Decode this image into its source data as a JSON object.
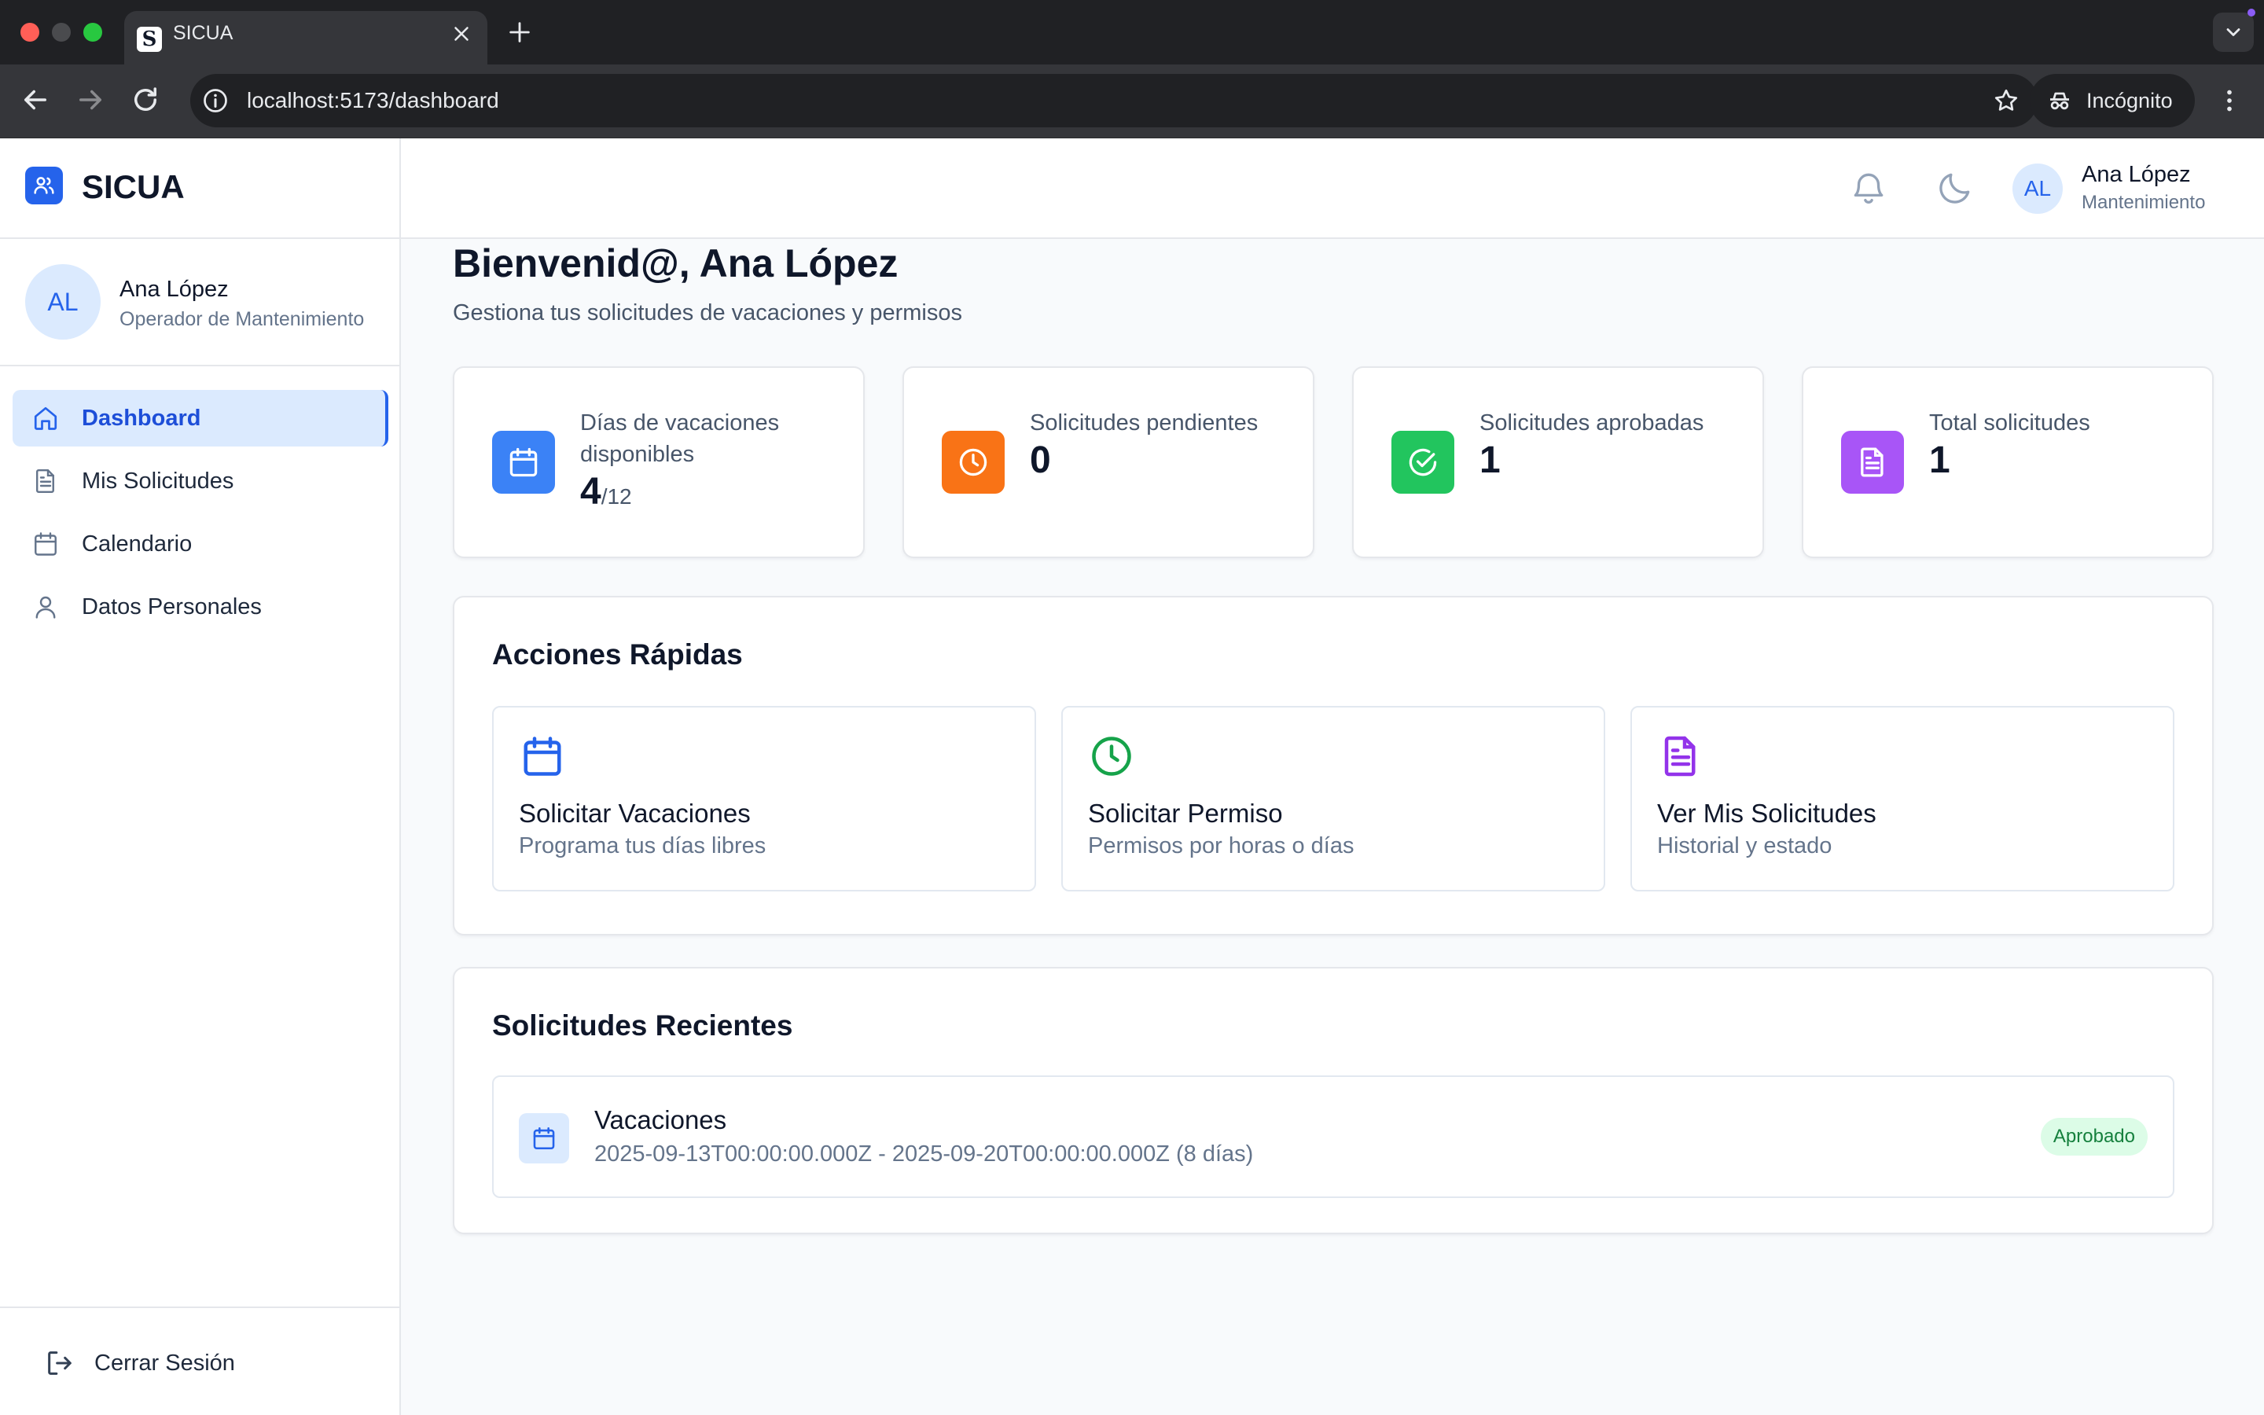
{
  "browser": {
    "tab_title": "SICUA",
    "favicon_letter": "S",
    "url": "localhost:5173/dashboard",
    "incognito_label": "Incógnito"
  },
  "app": {
    "name": "SICUA",
    "accent_color": "#2563eb"
  },
  "sidebar": {
    "user": {
      "initials": "AL",
      "name": "Ana López",
      "role": "Operador de Mantenimiento"
    },
    "items": [
      {
        "label": "Dashboard",
        "icon": "home-icon",
        "active": true
      },
      {
        "label": "Mis Solicitudes",
        "icon": "document-icon",
        "active": false
      },
      {
        "label": "Calendario",
        "icon": "calendar-icon",
        "active": false
      },
      {
        "label": "Datos Personales",
        "icon": "user-icon",
        "active": false
      }
    ],
    "logout_label": "Cerrar Sesión"
  },
  "header": {
    "user": {
      "initials": "AL",
      "name": "Ana López",
      "role": "Mantenimiento"
    }
  },
  "main": {
    "title": "Bienvenid@, Ana López",
    "subtitle": "Gestiona tus solicitudes de vacaciones y permisos",
    "stats": [
      {
        "label": "Días de vacaciones disponibles",
        "value": "4",
        "suffix": "/12",
        "icon": "calendar-icon",
        "color": "#3b82f6"
      },
      {
        "label": "Solicitudes pendientes",
        "value": "0",
        "icon": "clock-icon",
        "color": "#f97316"
      },
      {
        "label": "Solicitudes aprobadas",
        "value": "1",
        "icon": "check-circle-icon",
        "color": "#22c55e"
      },
      {
        "label": "Total solicitudes",
        "value": "1",
        "icon": "document-icon",
        "color": "#a855f7"
      }
    ],
    "quick_actions": {
      "title": "Acciones Rápidas",
      "items": [
        {
          "title": "Solicitar Vacaciones",
          "desc": "Programa tus días libres",
          "icon": "calendar-icon",
          "color": "#2563eb"
        },
        {
          "title": "Solicitar Permiso",
          "desc": "Permisos por horas o días",
          "icon": "clock-icon",
          "color": "#16a34a"
        },
        {
          "title": "Ver Mis Solicitudes",
          "desc": "Historial y estado",
          "icon": "document-icon",
          "color": "#9333ea"
        }
      ]
    },
    "recent": {
      "title": "Solicitudes Recientes",
      "items": [
        {
          "type": "Vacaciones",
          "range": "2025-09-13T00:00:00.000Z - 2025-09-20T00:00:00.000Z (8 días)",
          "status": "Aprobado",
          "icon": "calendar-icon"
        }
      ]
    }
  }
}
